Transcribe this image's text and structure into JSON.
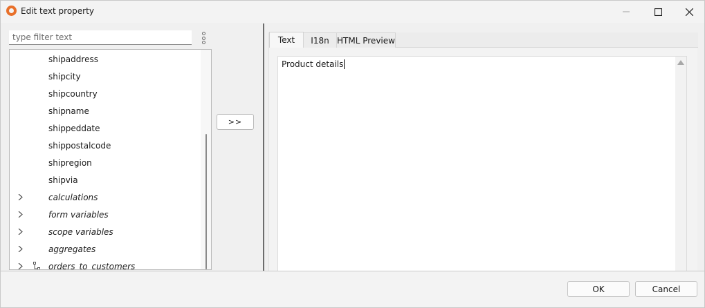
{
  "window": {
    "title": "Edit text property"
  },
  "filter": {
    "placeholder": "type filter text",
    "value": ""
  },
  "tree": {
    "items": [
      {
        "label": "shipaddress",
        "italic": false,
        "expandable": false,
        "relation": false
      },
      {
        "label": "shipcity",
        "italic": false,
        "expandable": false,
        "relation": false
      },
      {
        "label": "shipcountry",
        "italic": false,
        "expandable": false,
        "relation": false
      },
      {
        "label": "shipname",
        "italic": false,
        "expandable": false,
        "relation": false
      },
      {
        "label": "shippeddate",
        "italic": false,
        "expandable": false,
        "relation": false
      },
      {
        "label": "shippostalcode",
        "italic": false,
        "expandable": false,
        "relation": false
      },
      {
        "label": "shipregion",
        "italic": false,
        "expandable": false,
        "relation": false
      },
      {
        "label": "shipvia",
        "italic": false,
        "expandable": false,
        "relation": false
      },
      {
        "label": "calculations",
        "italic": true,
        "expandable": true,
        "relation": false
      },
      {
        "label": "form variables",
        "italic": true,
        "expandable": true,
        "relation": false
      },
      {
        "label": "scope variables",
        "italic": true,
        "expandable": true,
        "relation": false
      },
      {
        "label": "aggregates",
        "italic": true,
        "expandable": true,
        "relation": false
      },
      {
        "label": "orders_to_customers",
        "italic": true,
        "expandable": true,
        "relation": true
      }
    ]
  },
  "move_button": {
    "label": ">>"
  },
  "tabs": [
    {
      "label": "Text",
      "active": true
    },
    {
      "label": "I18n",
      "active": false
    },
    {
      "label": "HTML Preview",
      "active": false
    }
  ],
  "editor": {
    "value": "Product details"
  },
  "buttons": {
    "ok": "OK",
    "cancel": "Cancel"
  }
}
